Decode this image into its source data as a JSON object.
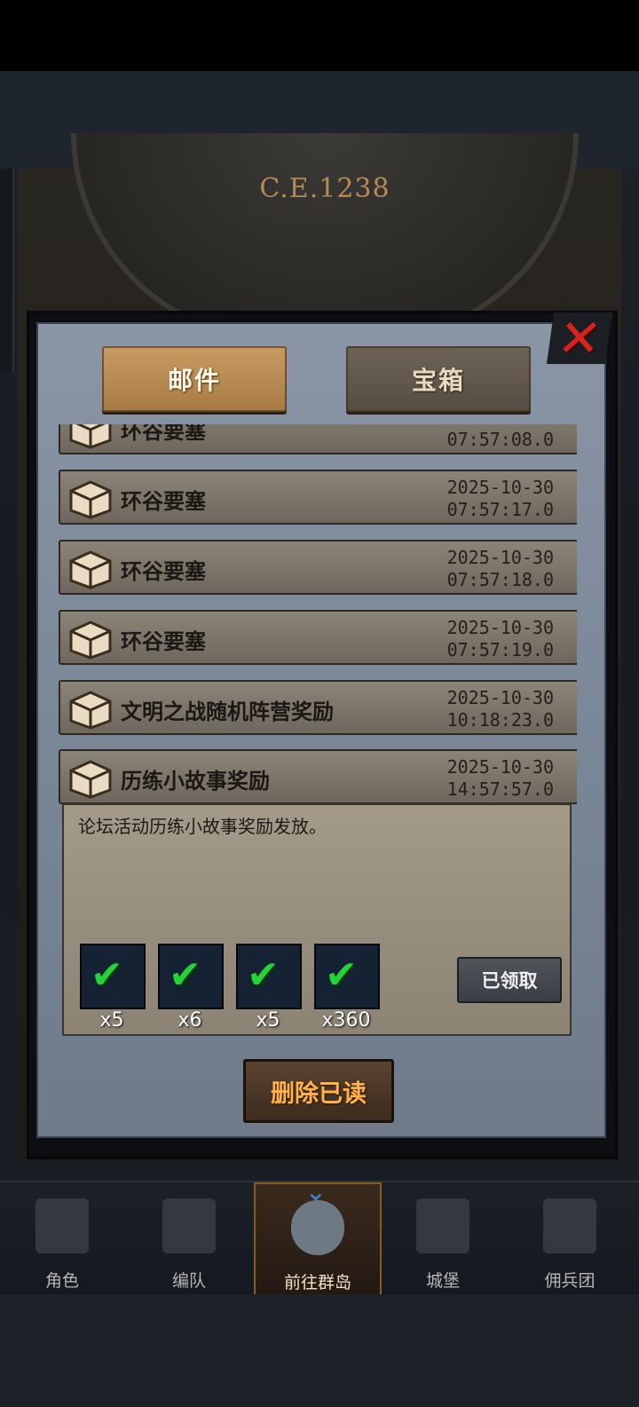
{
  "clock": {
    "year": "C.E.1238"
  },
  "tabs": [
    {
      "label": "邮件",
      "active": true
    },
    {
      "label": "宝箱",
      "active": false
    }
  ],
  "mails": [
    {
      "title": "环谷要塞",
      "date": "",
      "time": "07:57:08.0"
    },
    {
      "title": "环谷要塞",
      "date": "2025-10-30",
      "time": "07:57:17.0"
    },
    {
      "title": "环谷要塞",
      "date": "2025-10-30",
      "time": "07:57:18.0"
    },
    {
      "title": "环谷要塞",
      "date": "2025-10-30",
      "time": "07:57:19.0"
    },
    {
      "title": "文明之战随机阵营奖励",
      "date": "2025-10-30",
      "time": "10:18:23.0"
    },
    {
      "title": "历练小故事奖励",
      "date": "2025-10-30",
      "time": "14:57:57.0"
    }
  ],
  "expanded_mail": {
    "body": "论坛活动历练小故事奖励发放。",
    "rewards": [
      {
        "icon": "chest-bag-icon",
        "count": "x5"
      },
      {
        "icon": "blue-feather-icon",
        "count": "x6"
      },
      {
        "icon": "blue-potion-icon",
        "count": "x5"
      },
      {
        "icon": "scroll-icon",
        "count": "x360"
      }
    ],
    "claimed_label": "已领取"
  },
  "delete_read_label": "删除已读",
  "bottom_nav": [
    {
      "label": "角色",
      "icon": "knight-icon"
    },
    {
      "label": "编队",
      "icon": "helmet-icon"
    },
    {
      "label": "前往群岛",
      "icon": "globe-icon",
      "active": true
    },
    {
      "label": "城堡",
      "icon": "castle-icon"
    },
    {
      "label": "佣兵团",
      "icon": "mercenary-icon"
    }
  ],
  "colors": {
    "close": "#d8221c",
    "check": "#22d33a",
    "delete_text": "#ffb34a"
  }
}
